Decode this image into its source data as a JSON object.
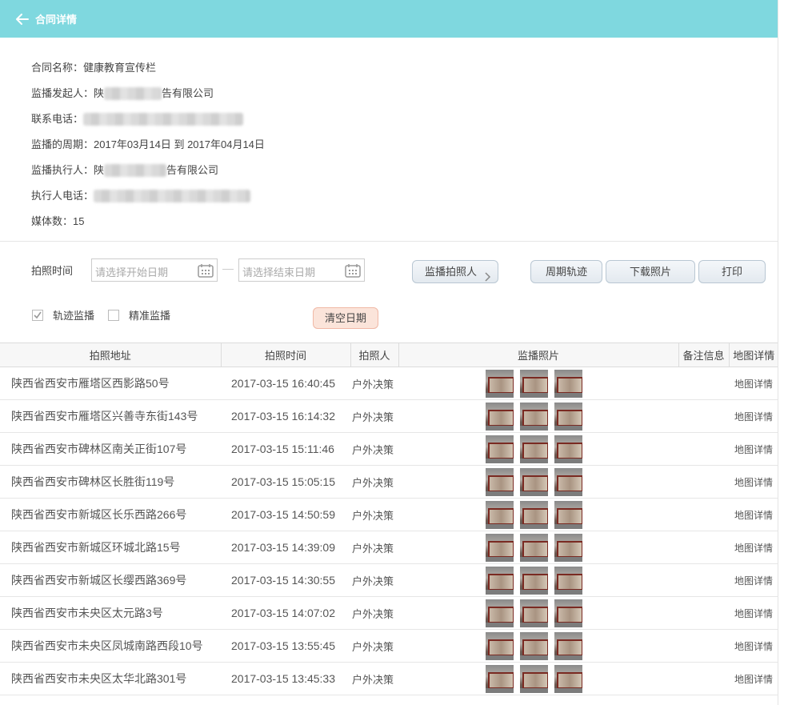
{
  "header": {
    "title": "合同详情"
  },
  "info": {
    "contract_name": "合同名称：健康教育宣传栏",
    "initiator_prefix": "监播发起人：陕",
    "initiator_suffix": "告有限公司",
    "phone_label": "联系电话：",
    "period": "监播的周期：2017年03月14日 到 2017年04月14日",
    "executor_prefix": "监播执行人：陕",
    "executor_suffix": "告有限公司",
    "executor_phone_label": "执行人电话：",
    "media_count": "媒体数：15"
  },
  "filters": {
    "photo_time_label": "拍照时间",
    "start_placeholder": "请选择开始日期",
    "end_placeholder": "请选择结束日期",
    "photographer_btn": "监播拍照人",
    "period_track_btn": "周期轨迹",
    "download_btn": "下载照片",
    "print_btn": "打印",
    "track_monitor": "轨迹监播",
    "precise_monitor": "精准监播",
    "clear_date_btn": "清空日期"
  },
  "table": {
    "headers": [
      "拍照地址",
      "拍照时间",
      "拍照人",
      "监播照片",
      "备注信息",
      "地图详情"
    ],
    "rows": [
      {
        "address": "陕西省西安市雁塔区西影路50号",
        "time": "2017-03-15 16:40:45",
        "person": "户外决策",
        "map": "地图详情"
      },
      {
        "address": "陕西省西安市雁塔区兴善寺东街143号",
        "time": "2017-03-15 16:14:32",
        "person": "户外决策",
        "map": "地图详情"
      },
      {
        "address": "陕西省西安市碑林区南关正街107号",
        "time": "2017-03-15 15:11:46",
        "person": "户外决策",
        "map": "地图详情"
      },
      {
        "address": "陕西省西安市碑林区长胜街119号",
        "time": "2017-03-15 15:05:15",
        "person": "户外决策",
        "map": "地图详情"
      },
      {
        "address": "陕西省西安市新城区长乐西路266号",
        "time": "2017-03-15 14:50:59",
        "person": "户外决策",
        "map": "地图详情"
      },
      {
        "address": "陕西省西安市新城区环城北路15号",
        "time": "2017-03-15 14:39:09",
        "person": "户外决策",
        "map": "地图详情"
      },
      {
        "address": "陕西省西安市新城区长缨西路369号",
        "time": "2017-03-15 14:30:55",
        "person": "户外决策",
        "map": "地图详情"
      },
      {
        "address": "陕西省西安市未央区太元路3号",
        "time": "2017-03-15 14:07:02",
        "person": "户外决策",
        "map": "地图详情"
      },
      {
        "address": "陕西省西安市未央区凤城南路西段10号",
        "time": "2017-03-15 13:55:45",
        "person": "户外决策",
        "map": "地图详情"
      },
      {
        "address": "陕西省西安市未央区太华北路301号",
        "time": "2017-03-15 13:45:33",
        "person": "户外决策",
        "map": "地图详情"
      }
    ]
  }
}
